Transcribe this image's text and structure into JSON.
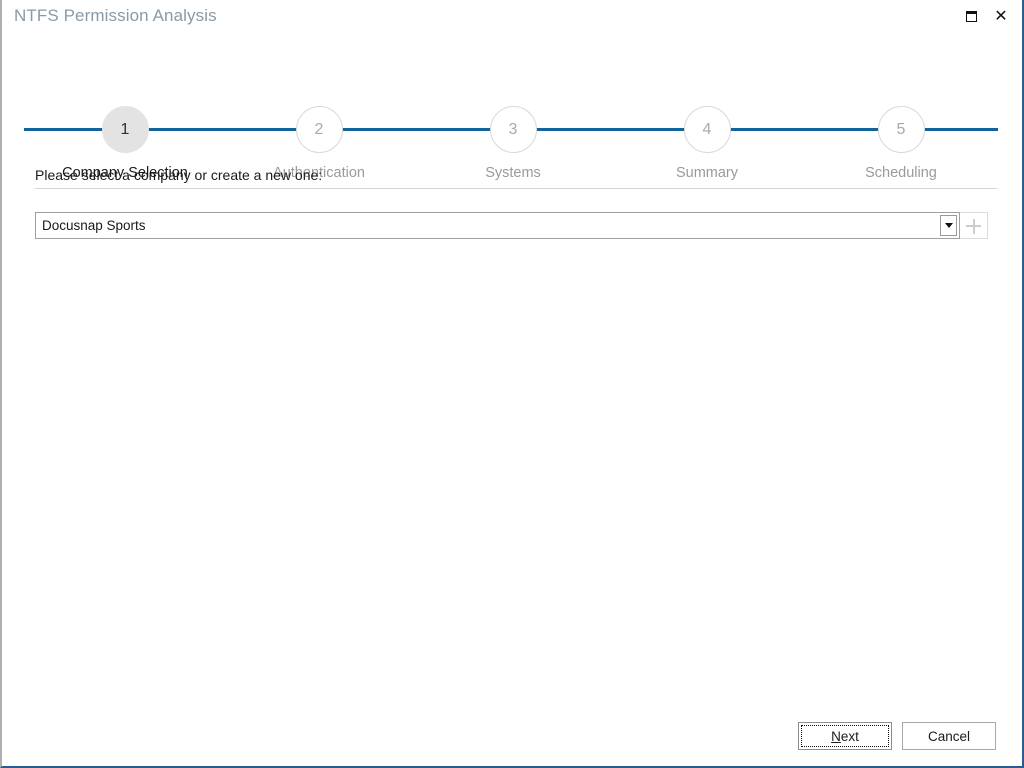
{
  "window": {
    "title": "NTFS Permission Analysis",
    "controls": [
      {
        "name": "restore-button",
        "icon": "restore-icon",
        "label": ""
      },
      {
        "name": "close-button",
        "icon": "close-icon",
        "label": "✕"
      }
    ],
    "accent_color": "#11639c",
    "border_right_color": "#2c5d8f",
    "border_left_color": "#b0b0b0"
  },
  "stepper": {
    "active_index": 1,
    "steps": [
      {
        "number": "1",
        "label": "Company Selection",
        "state": "active"
      },
      {
        "number": "2",
        "label": "Authentication",
        "state": "inactive"
      },
      {
        "number": "3",
        "label": "Systems",
        "state": "inactive"
      },
      {
        "number": "4",
        "label": "Summary",
        "state": "inactive"
      },
      {
        "number": "5",
        "label": "Scheduling",
        "state": "inactive"
      }
    ]
  },
  "main": {
    "instruction": "Please select a company or create a new one:",
    "company_select": {
      "value": "Docusnap Sports",
      "placeholder": "",
      "options": [
        "Docusnap Sports"
      ]
    },
    "add_company_button": {
      "icon": "plus-icon",
      "label": ""
    }
  },
  "footer": {
    "next": {
      "accel": "N",
      "rest": "ext",
      "label": "Next",
      "is_default": true
    },
    "cancel": {
      "label": "Cancel",
      "is_default": false
    }
  }
}
